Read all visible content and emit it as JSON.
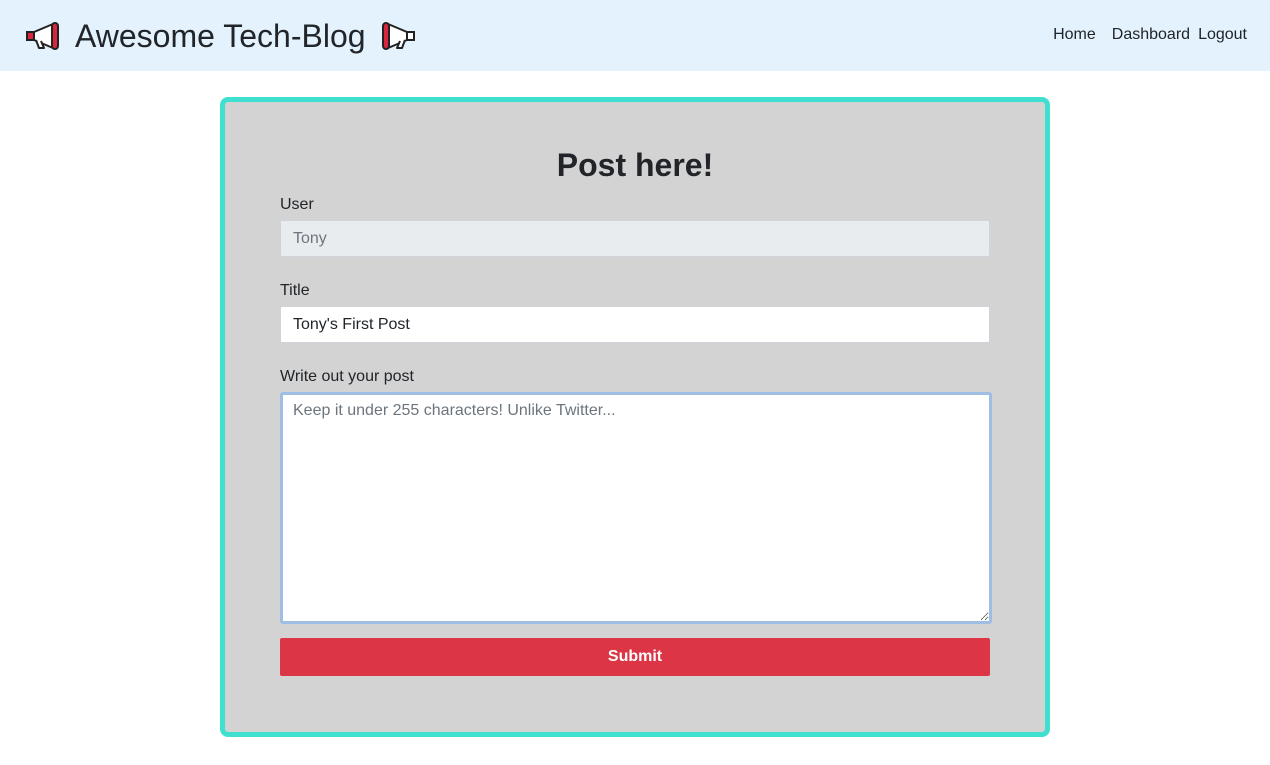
{
  "navbar": {
    "brand_title": "Awesome Tech-Blog",
    "left_icon": "megaphone-icon",
    "right_icon": "megaphone-icon",
    "links": [
      "Home",
      "Dashboard",
      "Logout"
    ],
    "background": "#e3f2fd"
  },
  "form": {
    "heading": "Post here!",
    "user_label": "User",
    "user_value": "Tony",
    "title_label": "Title",
    "title_value": "Tony's First Post",
    "post_label": "Write out your post",
    "post_placeholder": "Keep it under 255 characters! Unlike Twitter...",
    "submit_label": "Submit"
  },
  "colors": {
    "card_border": "#40e0d0",
    "card_background": "#d3d3d3",
    "submit_button": "#dc3545"
  }
}
